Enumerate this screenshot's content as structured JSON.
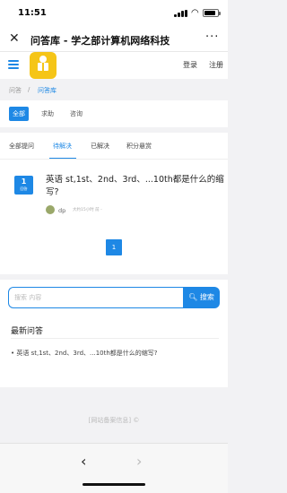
{
  "status_bar": {
    "time": "11:51"
  },
  "nav_bar": {
    "title": "问答库 - 学之部计算机网络科技",
    "more": "···"
  },
  "site_header": {
    "login": "登录",
    "register": "注册"
  },
  "breadcrumb": {
    "items": [
      "问答",
      "/",
      "问答库"
    ]
  },
  "categories": [
    "全部",
    "求助",
    "咨询"
  ],
  "tabs": [
    "全部提问",
    "待解决",
    "已解决",
    "积分悬赏"
  ],
  "question": {
    "answer_count": "1",
    "answer_label": "回答",
    "title": "英语 st,1st、2nd、3rd、...10th都是什么的缩写?",
    "author": "dp",
    "time": "大约15小时 前 -"
  },
  "pagination": {
    "current": "1"
  },
  "search": {
    "placeholder": "搜索 内容",
    "button": "搜索"
  },
  "latest": {
    "title": "最新问答",
    "items": [
      "英语 st,1st、2nd、3rd、...10th都是什么的缩写?"
    ]
  },
  "footer": {
    "text": "[网站备案信息] ©"
  },
  "colors": {
    "accent": "#1e88e5",
    "logo": "#f5c518"
  },
  "icons": [
    "close-icon",
    "more-icon",
    "menu-icon",
    "logo-icon",
    "search-icon",
    "back-arrow-icon",
    "forward-arrow-icon"
  ]
}
